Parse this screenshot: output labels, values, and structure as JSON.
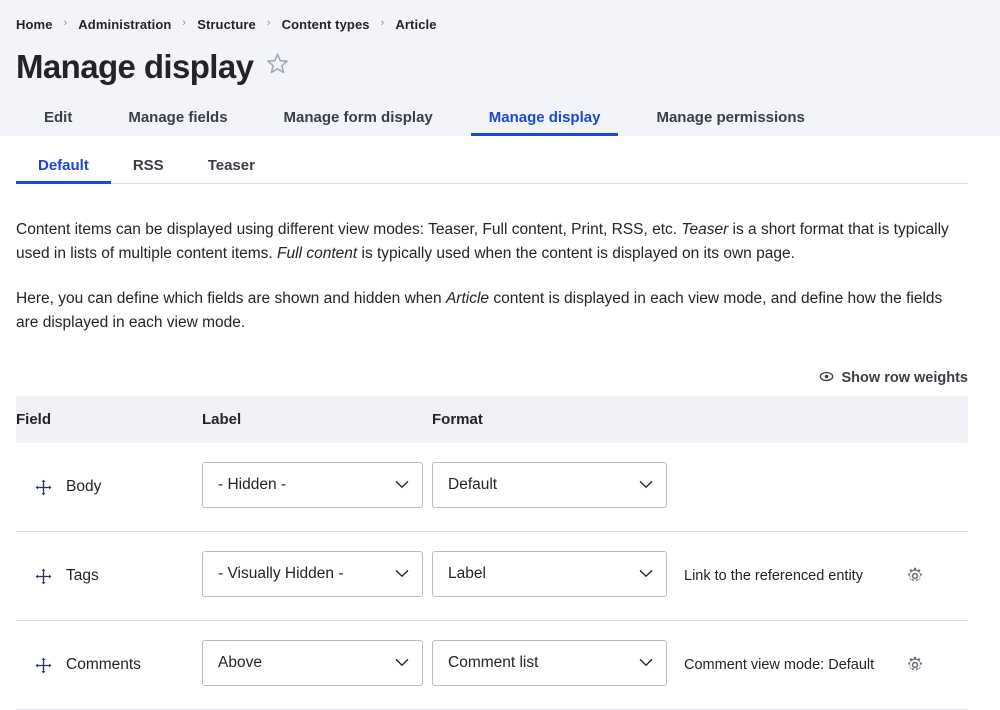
{
  "breadcrumb": {
    "separator": "›",
    "items": [
      {
        "label": "Home"
      },
      {
        "label": "Administration"
      },
      {
        "label": "Structure"
      },
      {
        "label": "Content types"
      },
      {
        "label": "Article"
      }
    ]
  },
  "header": {
    "title": "Manage display",
    "star_icon": "star-outline-icon"
  },
  "primary_tabs": [
    {
      "label": "Edit",
      "active": false
    },
    {
      "label": "Manage fields",
      "active": false
    },
    {
      "label": "Manage form display",
      "active": false
    },
    {
      "label": "Manage display",
      "active": true
    },
    {
      "label": "Manage permissions",
      "active": false
    }
  ],
  "secondary_tabs": [
    {
      "label": "Default",
      "active": true
    },
    {
      "label": "RSS",
      "active": false
    },
    {
      "label": "Teaser",
      "active": false
    }
  ],
  "intro": {
    "p1_part1": "Content items can be displayed using different view modes: Teaser, Full content, Print, RSS, etc. ",
    "p1_em1": "Teaser",
    "p1_part2": " is a short format that is typically used in lists of multiple content items. ",
    "p1_em2": "Full content",
    "p1_part3": " is typically used when the content is displayed on its own page.",
    "p2_part1": "Here, you can define which fields are shown and hidden when ",
    "p2_em1": "Article",
    "p2_part2": " content is displayed in each view mode, and define how the fields are displayed in each view mode."
  },
  "row_weights": {
    "label": "Show row weights",
    "icon": "eye-icon"
  },
  "table": {
    "columns": {
      "field": "Field",
      "label": "Label",
      "format": "Format",
      "summary": "",
      "settings": ""
    },
    "rows": [
      {
        "field": "Body",
        "drag_icon": "move-icon",
        "label_value": "- Hidden -",
        "format_value": "Default",
        "summary": "",
        "has_settings": false
      },
      {
        "field": "Tags",
        "drag_icon": "move-icon",
        "label_value": "- Visually Hidden -",
        "format_value": "Label",
        "summary": "Link to the referenced entity",
        "has_settings": true
      },
      {
        "field": "Comments",
        "drag_icon": "move-icon",
        "label_value": "Above",
        "format_value": "Comment list",
        "summary": "Comment view mode: Default",
        "has_settings": true
      }
    ],
    "settings_icon": "gear-icon"
  },
  "colors": {
    "accent": "#1b48d6",
    "header_bg": "#f3f4f9",
    "table_head_bg": "#f0f1f6",
    "border": "#dcdfe5",
    "text": "#232429",
    "drag_handle": "#2c3561"
  }
}
